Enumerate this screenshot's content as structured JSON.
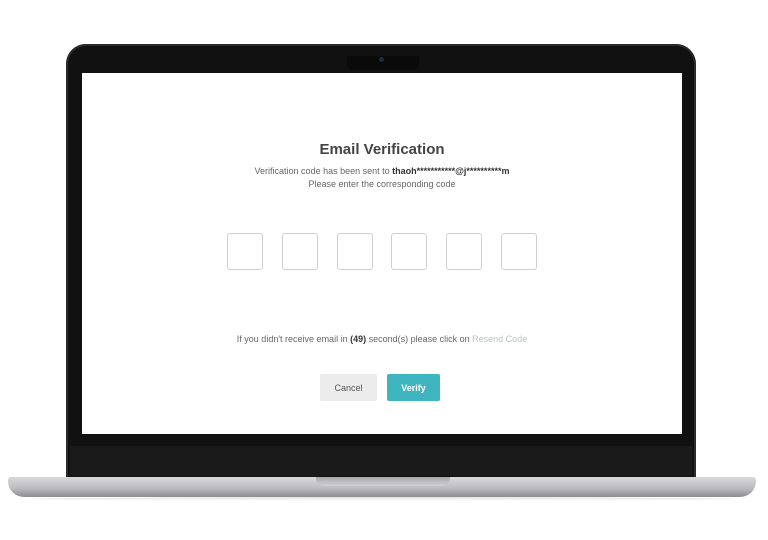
{
  "dialog": {
    "title": "Email Verification",
    "sent_prefix": "Verification code has been sent to ",
    "masked_email": "thaoh***********@j**********m",
    "instruction": "Please enter the corresponding code",
    "code_length": 6,
    "resend_prefix": "If you didn't receive email in ",
    "countdown": "(49)",
    "resend_middle": " second(s) please click on ",
    "resend_link": "Resend Code",
    "cancel_label": "Cancel",
    "verify_label": "Verify"
  },
  "colors": {
    "accent": "#3fb6bf",
    "cancel_bg": "#ececec",
    "link_disabled": "#b9c3c6"
  }
}
